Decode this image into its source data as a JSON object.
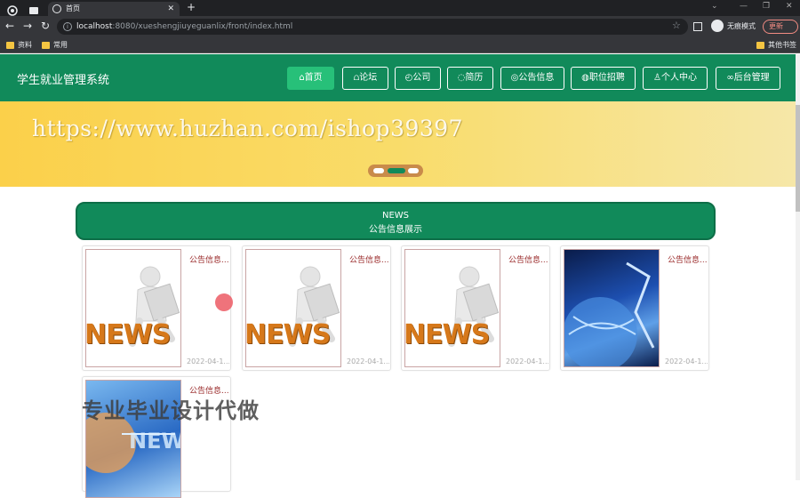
{
  "browser": {
    "tab_title": "首页",
    "url_host": "localhost",
    "url_rest": ":8080/xueshengjiuyeguanlix/front/index.html",
    "incognito_label": "无痕模式",
    "update_label": "更新",
    "bookmarks": [
      "资料",
      "常用"
    ],
    "other_bookmarks": "其他书签"
  },
  "site": {
    "title": "学生就业管理系统",
    "nav": [
      {
        "label": "首页",
        "icon": "home-icon",
        "active": true
      },
      {
        "label": "论坛",
        "icon": "forum-icon"
      },
      {
        "label": "公司",
        "icon": "company-icon"
      },
      {
        "label": "简历",
        "icon": "resume-icon"
      },
      {
        "label": "公告信息",
        "icon": "notice-icon"
      },
      {
        "label": "职位招聘",
        "icon": "job-icon"
      },
      {
        "label": "个人中心",
        "icon": "user-icon"
      },
      {
        "label": "后台管理",
        "icon": "link-icon"
      }
    ]
  },
  "banner": {
    "watermark": "https://www.huzhan.com/ishop39397",
    "active_slide": 2,
    "slide_count": 3
  },
  "news": {
    "heading_en": "NEWS",
    "heading_cn": "公告信息展示",
    "cards": [
      {
        "title": "公告信息...",
        "date": "2022-04-1...",
        "image": "news-figure"
      },
      {
        "title": "公告信息...",
        "date": "2022-04-1...",
        "image": "news-figure"
      },
      {
        "title": "公告信息...",
        "date": "2022-04-1...",
        "image": "news-figure"
      },
      {
        "title": "公告信息...",
        "date": "2022-04-1...",
        "image": "globe-news"
      },
      {
        "title": "公告信息...",
        "date": "",
        "image": "globe-news-2"
      }
    ]
  },
  "overlay_watermark": "专业毕业设计代做",
  "colors": {
    "header": "#118a5a",
    "nav_active": "#27c079",
    "card_title": "#9a2a2a"
  }
}
